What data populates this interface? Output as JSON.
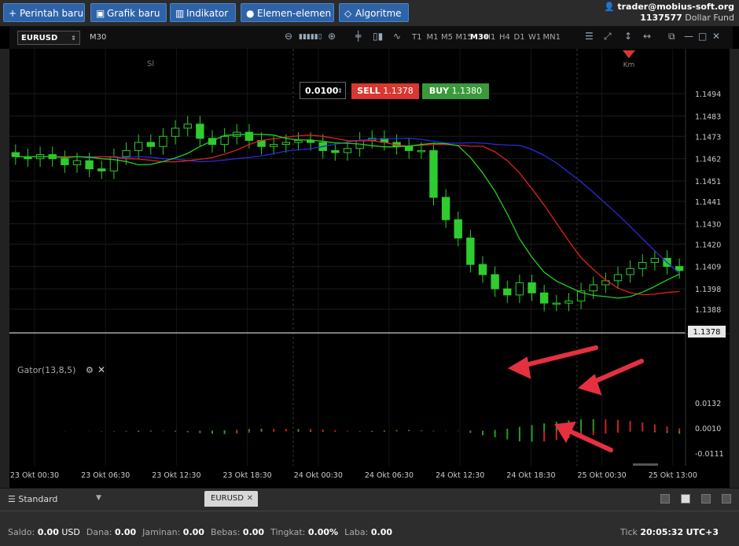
{
  "toolbar": {
    "new_order": "Perintah baru",
    "new_chart": "Grafik baru",
    "indicator": "Indikator",
    "elements": "Elemen-elemen",
    "algorithm": "Algoritme"
  },
  "account": {
    "email": "trader@mobius-soft.org",
    "number": "1137577",
    "fund": "Dollar Fund"
  },
  "chart_header": {
    "symbol": "EURUSD",
    "period": "M30",
    "timeframes": [
      "T1",
      "M1",
      "M5",
      "M15",
      "M30",
      "H1",
      "H4",
      "D1",
      "W1",
      "MN1"
    ],
    "active_timeframe": "M30"
  },
  "order_panel": {
    "lot": "0.0100",
    "sell_label": "SELL",
    "sell_price": "1.1378",
    "buy_label": "BUY",
    "buy_price": "1.1380"
  },
  "markers": {
    "sl": "Sl",
    "km": "Km"
  },
  "indicator": {
    "name": "Gator(13,8,5)"
  },
  "chart_data": {
    "type": "candlestick",
    "symbol": "EURUSD",
    "timeframe": "M30",
    "price_axis": [
      "1.1494",
      "1.1483",
      "1.1473",
      "1.1462",
      "1.1451",
      "1.1441",
      "1.1430",
      "1.1420",
      "1.1409",
      "1.1398",
      "1.1388"
    ],
    "current_price": "1.1378",
    "x_labels": [
      "23 Okt 00:30",
      "23 Okt 06:30",
      "23 Okt 12:30",
      "23 Okt 18:30",
      "24 Okt 00:30",
      "24 Okt 06:30",
      "24 Okt 12:30",
      "24 Okt 18:30",
      "25 Okt 00:30",
      "25 Okt 13:00"
    ],
    "gator_axis": [
      "0.0132",
      "0.0010",
      "-0.0111"
    ],
    "closes": [
      1.1463,
      1.1462,
      1.1464,
      1.1462,
      1.1459,
      1.1461,
      1.1457,
      1.1456,
      1.1463,
      1.1466,
      1.147,
      1.1468,
      1.1473,
      1.1477,
      1.1479,
      1.1472,
      1.1469,
      1.1473,
      1.1475,
      1.1471,
      1.1468,
      1.1469,
      1.147,
      1.1471,
      1.147,
      1.1466,
      1.1465,
      1.1467,
      1.1471,
      1.1472,
      1.147,
      1.1468,
      1.1466,
      1.1466,
      1.1443,
      1.1432,
      1.1423,
      1.141,
      1.1405,
      1.1398,
      1.1395,
      1.1401,
      1.1396,
      1.1391,
      1.1391,
      1.1392,
      1.1397,
      1.14,
      1.1402,
      1.1405,
      1.1408,
      1.1411,
      1.1413,
      1.1409,
      1.1407
    ]
  }
}
